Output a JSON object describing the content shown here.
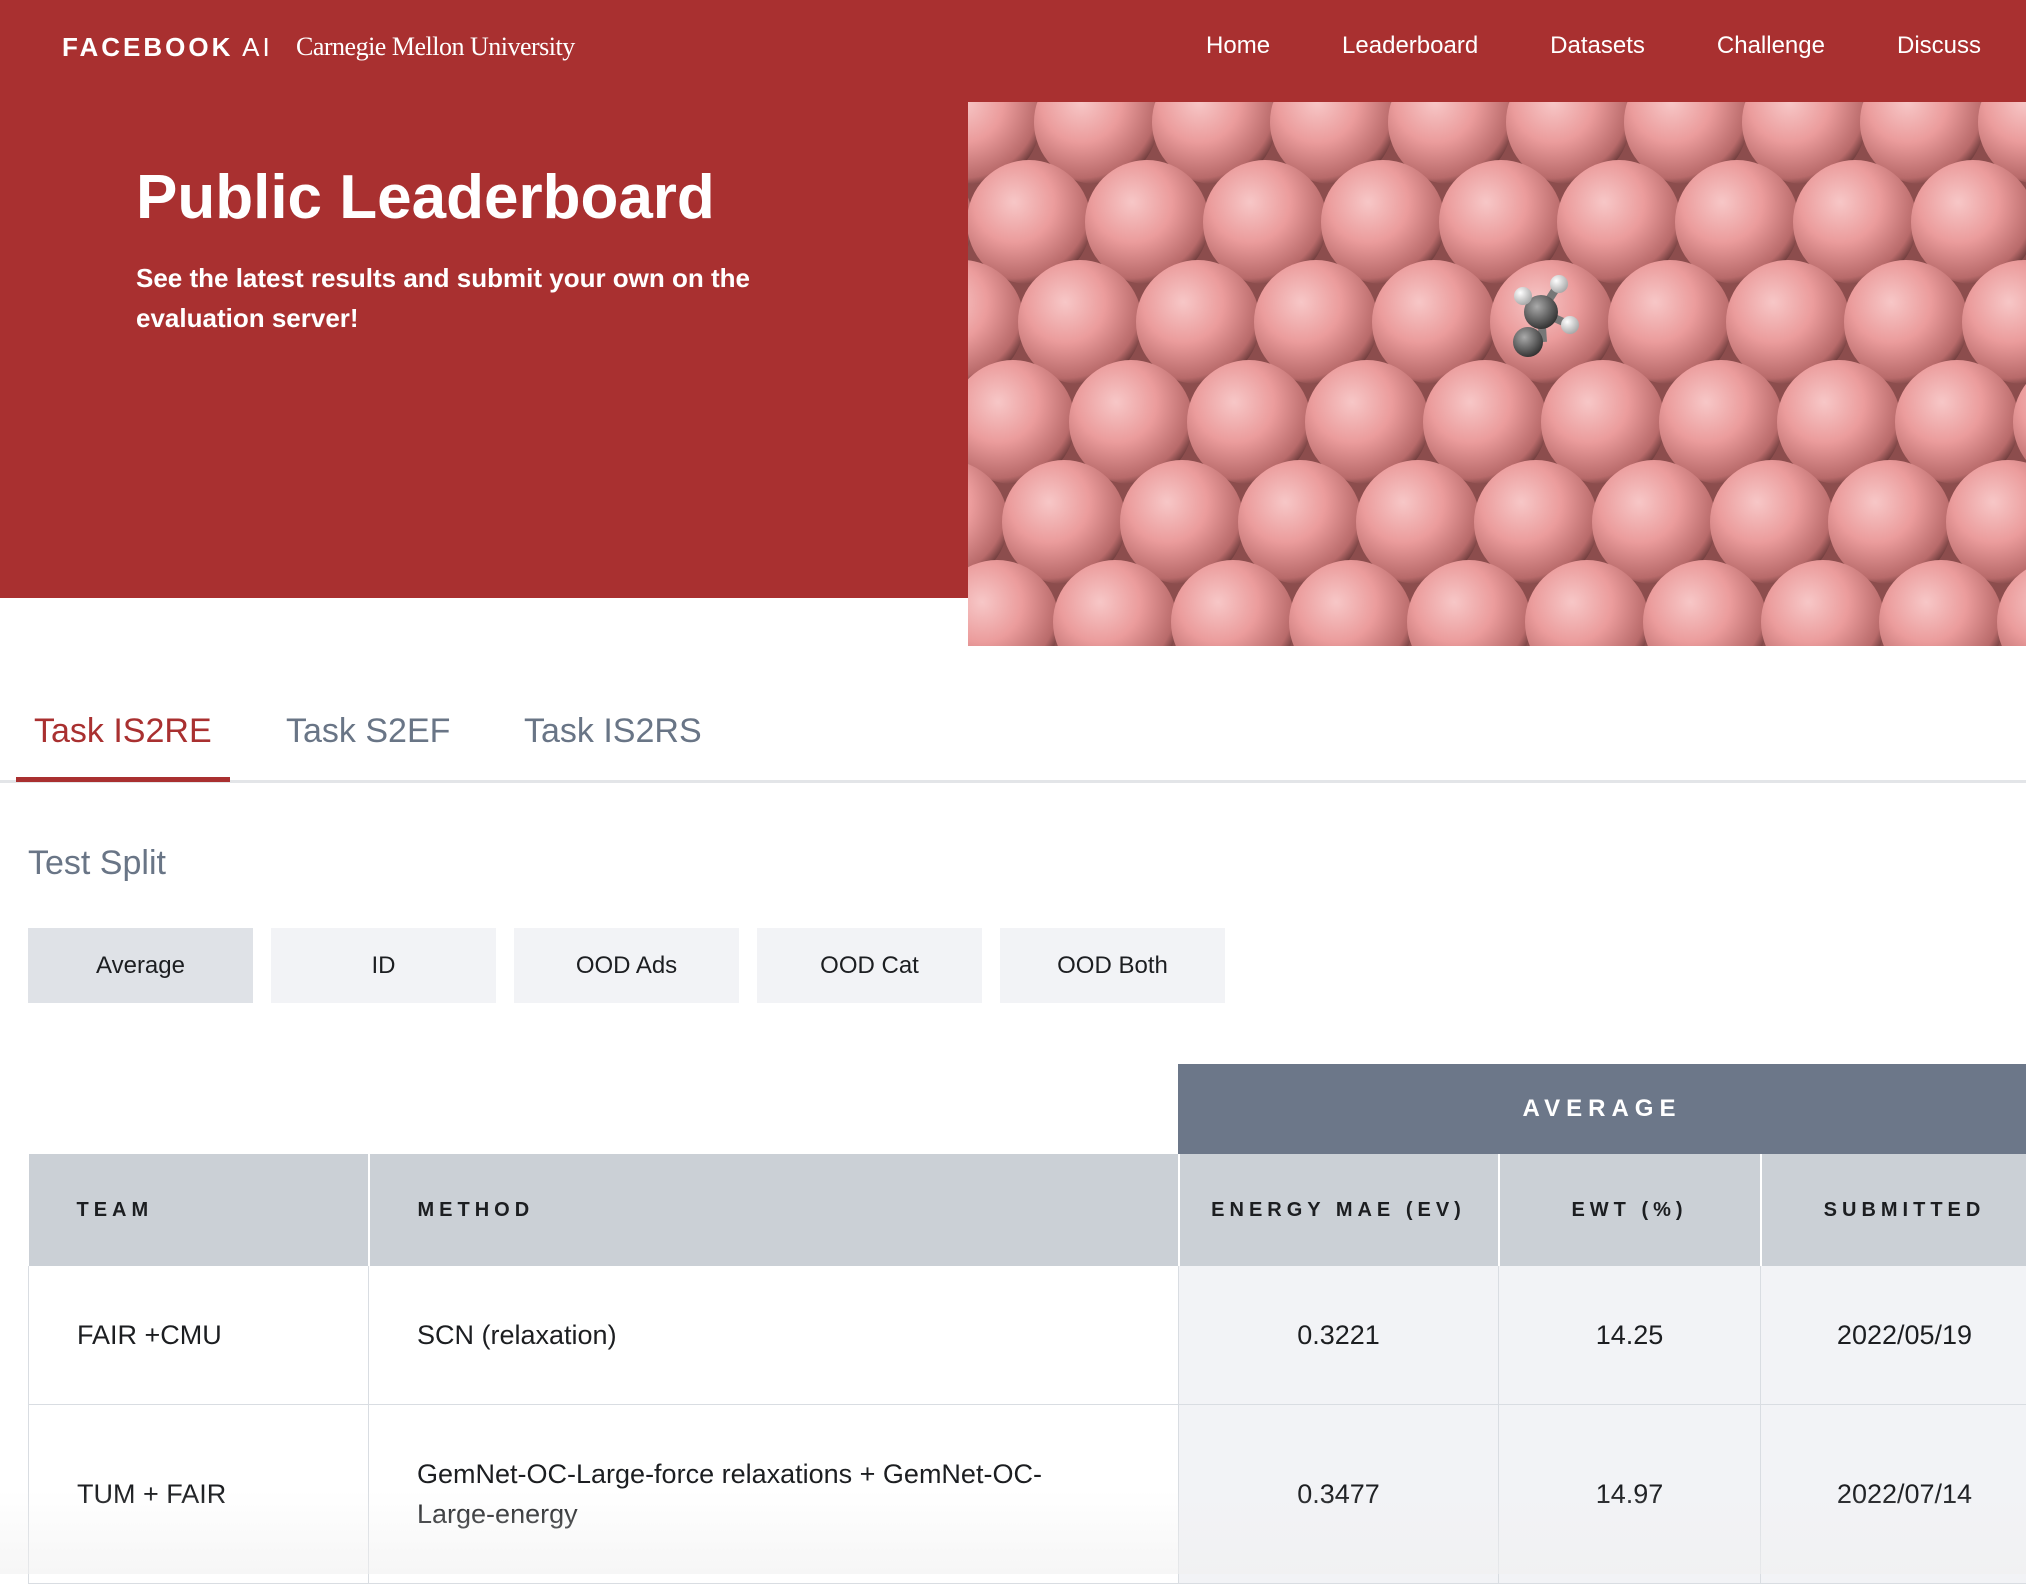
{
  "brand": {
    "facebook_main": "FACEBOOK",
    "facebook_suffix": "AI",
    "cmu": "Carnegie Mellon University"
  },
  "nav": {
    "items": [
      "Home",
      "Leaderboard",
      "Datasets",
      "Challenge",
      "Discuss"
    ]
  },
  "hero": {
    "title": "Public Leaderboard",
    "subtitle_prefix": "See the latest results and submit your own on",
    "subtitle_link": "the evaluation server",
    "subtitle_suffix": "!"
  },
  "tabs": [
    {
      "label": "Task IS2RE",
      "active": true
    },
    {
      "label": "Task S2EF",
      "active": false
    },
    {
      "label": "Task IS2RS",
      "active": false
    }
  ],
  "test_split": {
    "label": "Test Split",
    "options": [
      {
        "label": "Average",
        "active": true
      },
      {
        "label": "ID",
        "active": false
      },
      {
        "label": "OOD Ads",
        "active": false
      },
      {
        "label": "OOD Cat",
        "active": false
      },
      {
        "label": "OOD Both",
        "active": false
      }
    ]
  },
  "table": {
    "group_header": "AVERAGE",
    "columns": [
      "TEAM",
      "METHOD",
      "ENERGY MAE (EV)",
      "EWT (%)",
      "SUBMITTED"
    ],
    "rows": [
      {
        "team": "FAIR +CMU",
        "method": "SCN (relaxation)",
        "energy_mae": "0.3221",
        "ewt": "14.25",
        "submitted": "2022/05/19"
      },
      {
        "team": "TUM + FAIR",
        "method": "GemNet-OC-Large-force relaxations + GemNet-OC-Large-energy",
        "energy_mae": "0.3477",
        "ewt": "14.97",
        "submitted": "2022/07/14"
      }
    ]
  },
  "colors": {
    "brand_red": "#a93030",
    "header_slate": "#6c7789",
    "header_gray": "#cbd0d6",
    "tab_inactive": "#697586",
    "atom_pink": "#f0a0a0"
  },
  "icons": {
    "hero_image": "metal-surface-adsorbate-image"
  }
}
